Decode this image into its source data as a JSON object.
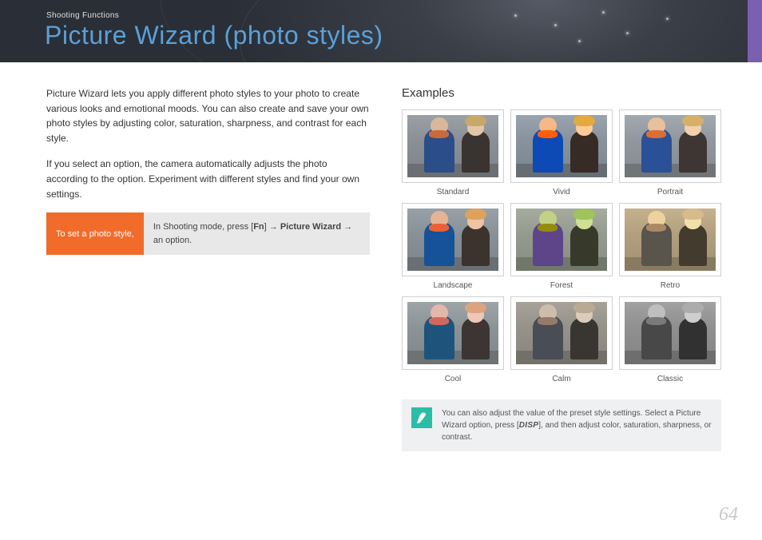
{
  "header": {
    "breadcrumb": "Shooting Functions",
    "title": "Picture Wizard (photo styles)"
  },
  "body": {
    "p1": "Picture Wizard lets you apply different photo styles to your photo to create various looks and emotional moods. You can also create and save your own photo styles by adjusting color, saturation, sharpness, and contrast for each style.",
    "p2": "If you select an option, the camera automatically adjusts the photo according to the option. Experiment with different styles and find your own settings."
  },
  "instruction": {
    "label": "To set a photo style,",
    "prefix": "In Shooting mode, press [",
    "fn": "Fn",
    "mid": "] → ",
    "bold": "Picture Wizard",
    "suffix": " → an option."
  },
  "examples": {
    "title": "Examples",
    "items": [
      {
        "label": "Standard",
        "filter": "f-standard"
      },
      {
        "label": "Vivid",
        "filter": "f-vivid"
      },
      {
        "label": "Portrait",
        "filter": "f-portrait"
      },
      {
        "label": "Landscape",
        "filter": "f-landscape"
      },
      {
        "label": "Forest",
        "filter": "f-forest"
      },
      {
        "label": "Retro",
        "filter": "f-retro"
      },
      {
        "label": "Cool",
        "filter": "f-cool"
      },
      {
        "label": "Calm",
        "filter": "f-calm"
      },
      {
        "label": "Classic",
        "filter": "f-classic"
      }
    ]
  },
  "note": {
    "prefix": "You can also adjust the value of the preset style settings. Select a Picture Wizard option, press [",
    "disp": "DISP",
    "suffix": "], and then adjust color, saturation, sharpness, or contrast."
  },
  "page_number": "64"
}
